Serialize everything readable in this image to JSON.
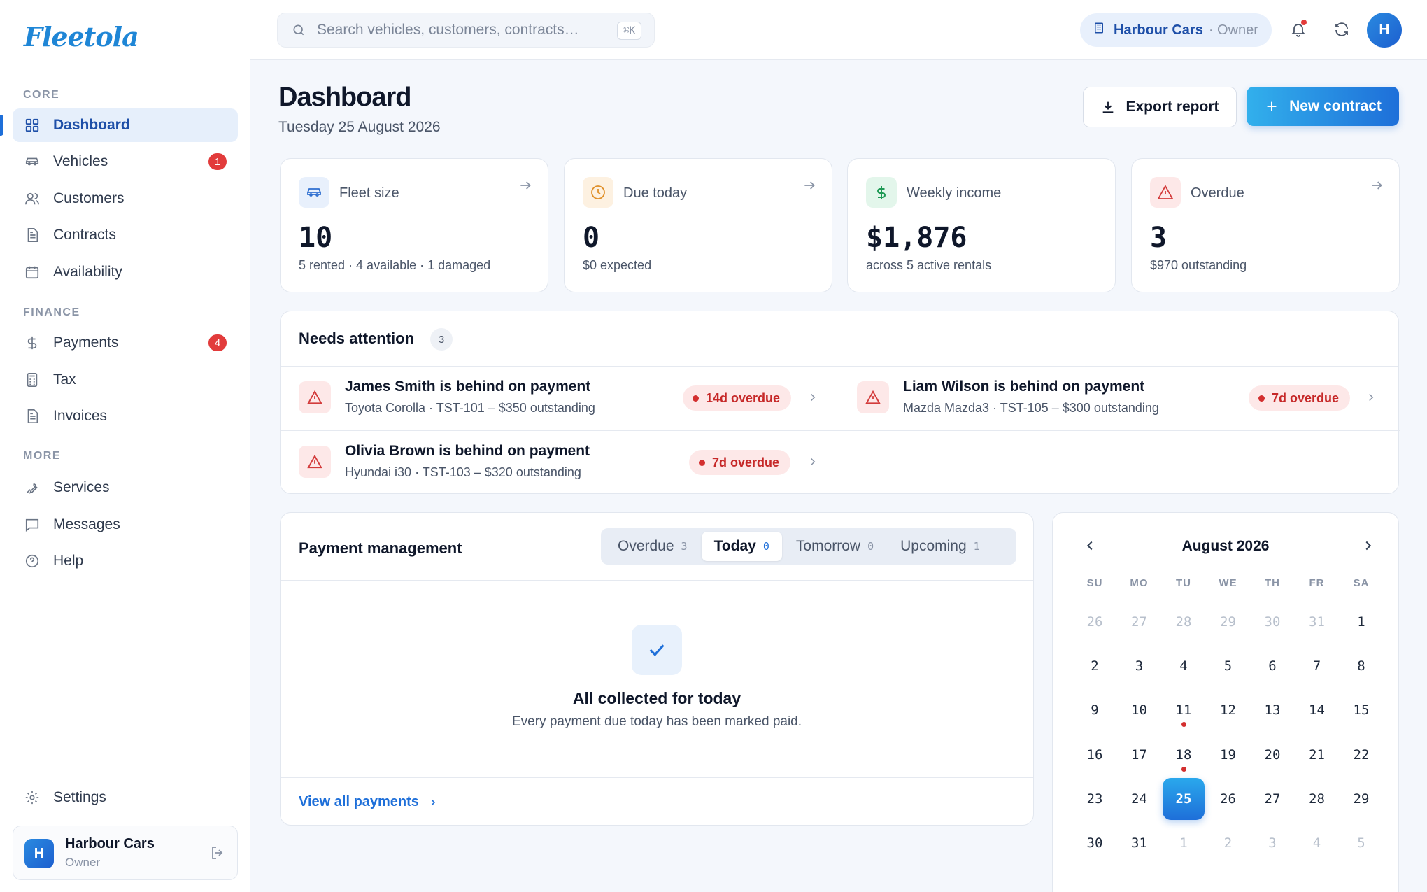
{
  "brand": {
    "logo": "Fleetola"
  },
  "sidebar": {
    "sections": [
      {
        "title": "CORE",
        "items": [
          {
            "label": "Dashboard",
            "icon": "grid-icon",
            "active": true
          },
          {
            "label": "Vehicles",
            "icon": "car-icon",
            "badge": "1"
          },
          {
            "label": "Customers",
            "icon": "users-icon"
          },
          {
            "label": "Contracts",
            "icon": "document-icon"
          },
          {
            "label": "Availability",
            "icon": "calendar-icon"
          }
        ]
      },
      {
        "title": "FINANCE",
        "items": [
          {
            "label": "Payments",
            "icon": "dollar-icon",
            "badge": "4"
          },
          {
            "label": "Tax",
            "icon": "calculator-icon"
          },
          {
            "label": "Invoices",
            "icon": "invoice-icon"
          }
        ]
      },
      {
        "title": "MORE",
        "items": [
          {
            "label": "Services",
            "icon": "wrench-icon"
          },
          {
            "label": "Messages",
            "icon": "message-icon"
          },
          {
            "label": "Help",
            "icon": "help-icon"
          }
        ]
      }
    ],
    "settings_label": "Settings",
    "user": {
      "initial": "H",
      "name": "Harbour Cars",
      "role": "Owner"
    }
  },
  "topbar": {
    "search_placeholder": "Search vehicles, customers, contracts…",
    "shortcut": "⌘K",
    "org_name": "Harbour Cars",
    "org_role": "· Owner",
    "avatar_initial": "H"
  },
  "header": {
    "title": "Dashboard",
    "date": "Tuesday 25 August 2026",
    "export_label": "Export report",
    "new_label": "New contract"
  },
  "stats": [
    {
      "label": "Fleet size",
      "value": "10",
      "sub": "5 rented · 4 available · 1 damaged",
      "icon": "car-icon",
      "color": "#2f6fd0",
      "bg": "#e8f0fc"
    },
    {
      "label": "Due today",
      "value": "0",
      "sub": "$0 expected",
      "icon": "clock-icon",
      "color": "#e0902a",
      "bg": "#fdf1e1"
    },
    {
      "label": "Weekly income",
      "value": "$1,876",
      "sub": "across 5 active rentals",
      "icon": "dollar-icon",
      "color": "#1f9a55",
      "bg": "#e3f6eb"
    },
    {
      "label": "Overdue",
      "value": "3",
      "sub": "$970 outstanding",
      "icon": "alert-icon",
      "color": "#d33b3b",
      "bg": "#fde8e8"
    }
  ],
  "attention": {
    "title": "Needs attention",
    "count": "3",
    "items": [
      {
        "title": "James Smith is behind on payment",
        "detail": "Toyota Corolla · TST-101 – $350 outstanding",
        "pill": "14d overdue"
      },
      {
        "title": "Liam Wilson is behind on payment",
        "detail": "Mazda Mazda3 · TST-105 – $300 outstanding",
        "pill": "7d overdue"
      },
      {
        "title": "Olivia Brown is behind on payment",
        "detail": "Hyundai i30 · TST-103 – $320 outstanding",
        "pill": "7d overdue"
      }
    ]
  },
  "payments": {
    "title": "Payment management",
    "tabs": [
      {
        "label": "Overdue",
        "count": "3"
      },
      {
        "label": "Today",
        "count": "0",
        "active": true
      },
      {
        "label": "Tomorrow",
        "count": "0"
      },
      {
        "label": "Upcoming",
        "count": "1"
      }
    ],
    "empty_title": "All collected for today",
    "empty_sub": "Every payment due today has been marked paid.",
    "link": "View all payments"
  },
  "calendar": {
    "title": "August 2026",
    "weekdays": [
      "SU",
      "MO",
      "TU",
      "WE",
      "TH",
      "FR",
      "SA"
    ],
    "days": [
      {
        "d": "26",
        "m": true
      },
      {
        "d": "27",
        "m": true
      },
      {
        "d": "28",
        "m": true
      },
      {
        "d": "29",
        "m": true
      },
      {
        "d": "30",
        "m": true
      },
      {
        "d": "31",
        "m": true
      },
      {
        "d": "1"
      },
      {
        "d": "2"
      },
      {
        "d": "3"
      },
      {
        "d": "4"
      },
      {
        "d": "5"
      },
      {
        "d": "6"
      },
      {
        "d": "7"
      },
      {
        "d": "8"
      },
      {
        "d": "9"
      },
      {
        "d": "10"
      },
      {
        "d": "11",
        "dot": true
      },
      {
        "d": "12"
      },
      {
        "d": "13"
      },
      {
        "d": "14"
      },
      {
        "d": "15"
      },
      {
        "d": "16"
      },
      {
        "d": "17"
      },
      {
        "d": "18",
        "dot": true
      },
      {
        "d": "19"
      },
      {
        "d": "20"
      },
      {
        "d": "21"
      },
      {
        "d": "22"
      },
      {
        "d": "23"
      },
      {
        "d": "24"
      },
      {
        "d": "25",
        "sel": true
      },
      {
        "d": "26"
      },
      {
        "d": "27"
      },
      {
        "d": "28"
      },
      {
        "d": "29"
      },
      {
        "d": "30"
      },
      {
        "d": "31"
      },
      {
        "d": "1",
        "m": true
      },
      {
        "d": "2",
        "m": true
      },
      {
        "d": "3",
        "m": true
      },
      {
        "d": "4",
        "m": true
      },
      {
        "d": "5",
        "m": true
      }
    ]
  }
}
